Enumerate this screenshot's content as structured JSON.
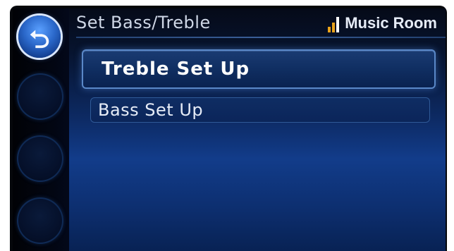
{
  "header": {
    "title": "Set Bass/Treble",
    "source_label": "Music Room",
    "source_icon": "signal-strength-icon"
  },
  "sidebar": {
    "back_icon": "back-arrow-icon"
  },
  "menu": {
    "items": [
      {
        "label": "Treble Set Up",
        "selected": true
      },
      {
        "label": "Bass Set Up",
        "selected": false
      }
    ]
  },
  "colors": {
    "accent": "#e8a21a",
    "highlight_border": "#5a88c8",
    "background_blue": "#123c8a"
  }
}
